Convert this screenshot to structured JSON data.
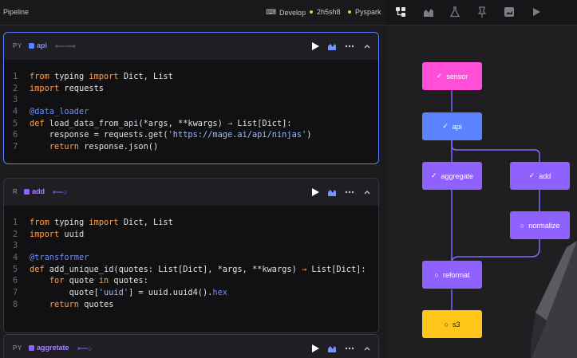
{
  "header": {
    "title": "Pipeline",
    "develop": "Develop",
    "commit": "2h5sh8",
    "engine": "Pyspark"
  },
  "colors": {
    "data_loader": "#5b82ff",
    "transformer": "#8f62ff",
    "sensor": "#ff4fd8",
    "exporter": "#ffc619",
    "edge": "#7b6cff"
  },
  "toolbar_icons": [
    "tree-icon",
    "chart-icon",
    "flask-icon",
    "pin-icon",
    "image-icon",
    "play-icon"
  ],
  "blocks": [
    {
      "lang": "PY",
      "name": "api",
      "icon": "⟵⟶",
      "lines": [
        [
          [
            "kw",
            "from"
          ],
          [
            "tx",
            " typing "
          ],
          [
            "kw",
            "import"
          ],
          [
            "tx",
            " Dict, List"
          ]
        ],
        [
          [
            "kw",
            "import"
          ],
          [
            "tx",
            " requests"
          ]
        ],
        [],
        [
          [
            "dec",
            "@data_loader"
          ]
        ],
        [
          [
            "kw",
            "def"
          ],
          [
            "fn",
            " load_data_from_api"
          ],
          [
            "tx",
            "(*args, **kwargs) "
          ],
          [
            "kw",
            "→"
          ],
          [
            "tx",
            " List[Dict]:"
          ]
        ],
        [
          [
            "tx",
            "    response = requests.get("
          ],
          [
            "str",
            "'https://mage.ai/api/ninjas'"
          ],
          [
            "tx",
            ")"
          ]
        ],
        [
          [
            "tx",
            "    "
          ],
          [
            "kw",
            "return"
          ],
          [
            "tx",
            " response.json()"
          ]
        ]
      ]
    },
    {
      "lang": "R",
      "name": "add",
      "icon": "⟵○",
      "lines": [
        [
          [
            "kw",
            "from"
          ],
          [
            "tx",
            " typing "
          ],
          [
            "kw",
            "import"
          ],
          [
            "tx",
            " Dict, List"
          ]
        ],
        [
          [
            "kw",
            "import"
          ],
          [
            "tx",
            " uuid"
          ]
        ],
        [],
        [
          [
            "dec",
            "@transformer"
          ]
        ],
        [
          [
            "kw",
            "def"
          ],
          [
            "fn",
            " add_unique_id"
          ],
          [
            "tx",
            "(quotes: List[Dict], *args, **kwargs) "
          ],
          [
            "kw",
            "→"
          ],
          [
            "tx",
            " List[Dict]:"
          ]
        ],
        [
          [
            "tx",
            "    "
          ],
          [
            "kw",
            "for"
          ],
          [
            "tx",
            " quote "
          ],
          [
            "kw",
            "in"
          ],
          [
            "tx",
            " quotes:"
          ]
        ],
        [
          [
            "tx",
            "        quote["
          ],
          [
            "str",
            "'uuid'"
          ],
          [
            "tx",
            "] = uuid.uuid4()."
          ],
          [
            "dec",
            "hex"
          ]
        ],
        [
          [
            "tx",
            "    "
          ],
          [
            "kw",
            "return"
          ],
          [
            "tx",
            " quotes"
          ]
        ]
      ]
    },
    {
      "lang": "PY",
      "name": "aggretate",
      "icon": "⟵○",
      "lines": []
    }
  ],
  "nodes": [
    {
      "id": "sensor",
      "label": "sensor",
      "status": "✓",
      "kind": "sensor"
    },
    {
      "id": "api",
      "label": "api",
      "status": "✓",
      "kind": "data_loader"
    },
    {
      "id": "aggregate",
      "label": "aggregate",
      "status": "✓",
      "kind": "transformer"
    },
    {
      "id": "add",
      "label": "add",
      "status": "✓",
      "kind": "transformer"
    },
    {
      "id": "normalize",
      "label": "normalize",
      "status": "○",
      "kind": "transformer"
    },
    {
      "id": "reformat",
      "label": "reformat",
      "status": "○",
      "kind": "transformer"
    },
    {
      "id": "s3",
      "label": "s3",
      "status": "○",
      "kind": "exporter"
    }
  ]
}
